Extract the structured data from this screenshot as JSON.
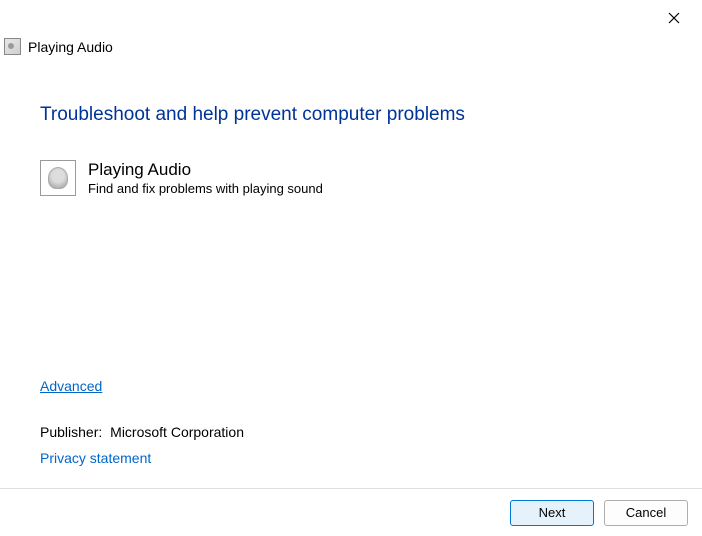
{
  "window": {
    "title": "Playing Audio"
  },
  "main": {
    "heading": "Troubleshoot and help prevent computer problems",
    "troubleshooter": {
      "name": "Playing Audio",
      "description": "Find and fix problems with playing sound"
    },
    "advanced_label": "Advanced",
    "publisher_label": "Publisher:",
    "publisher_value": "Microsoft Corporation",
    "privacy_label": "Privacy statement"
  },
  "footer": {
    "next_label": "Next",
    "cancel_label": "Cancel"
  }
}
